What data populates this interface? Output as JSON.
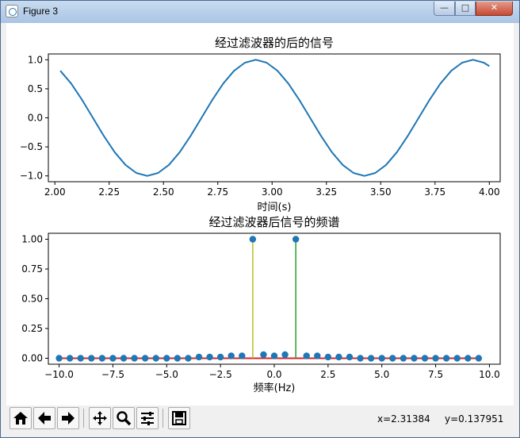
{
  "window": {
    "title": "Figure 3",
    "min_glyph": "—",
    "max_glyph": "□",
    "close_glyph": "✕"
  },
  "toolbar": {
    "buttons": [
      "home-icon",
      "back-arrow-icon",
      "forward-arrow-icon",
      "pan-icon",
      "zoom-icon",
      "subplots-config-icon",
      "save-icon"
    ],
    "x_readout": "x=2.31384",
    "y_readout": "y=0.137951"
  },
  "colors": {
    "line": "#1f77b4",
    "stem_neg": "#bcbd22",
    "stem_pos": "#2ca02c",
    "baseline": "#d62728",
    "marker": "#1f77b4"
  },
  "chart_data": [
    {
      "type": "line",
      "title": "经过滤波器的后的信号",
      "xlabel": "时间(s)",
      "ylabel": "",
      "xlim": [
        1.97,
        4.05
      ],
      "ylim": [
        -1.1,
        1.1
      ],
      "xticks": [
        2.0,
        2.25,
        2.5,
        2.75,
        3.0,
        3.25,
        3.5,
        3.75,
        4.0
      ],
      "xtick_labels": [
        "2.00",
        "2.25",
        "2.50",
        "2.75",
        "3.00",
        "3.25",
        "3.50",
        "3.75",
        "4.00"
      ],
      "yticks": [
        1.0,
        0.5,
        0.0,
        -0.5,
        -1.0
      ],
      "ytick_labels": [
        "1.0",
        "0.5",
        "0.0",
        "−0.5",
        "−1.0"
      ],
      "series": [
        {
          "x": [
            2.025,
            2.075,
            2.125,
            2.175,
            2.225,
            2.275,
            2.325,
            2.375,
            2.425,
            2.475,
            2.525,
            2.575,
            2.625,
            2.675,
            2.725,
            2.775,
            2.825,
            2.875,
            2.925,
            2.975,
            3.025,
            3.075,
            3.125,
            3.175,
            3.225,
            3.275,
            3.325,
            3.375,
            3.425,
            3.475,
            3.525,
            3.575,
            3.625,
            3.675,
            3.725,
            3.775,
            3.825,
            3.875,
            3.925,
            3.975,
            4.0
          ],
          "y": [
            0.81,
            0.59,
            0.31,
            0.0,
            -0.31,
            -0.59,
            -0.81,
            -0.95,
            -1.0,
            -0.95,
            -0.81,
            -0.59,
            -0.31,
            0.0,
            0.31,
            0.59,
            0.81,
            0.95,
            1.0,
            0.95,
            0.81,
            0.59,
            0.31,
            0.0,
            -0.31,
            -0.59,
            -0.81,
            -0.95,
            -1.0,
            -0.95,
            -0.81,
            -0.59,
            -0.31,
            0.0,
            0.31,
            0.59,
            0.81,
            0.95,
            1.0,
            0.95,
            0.89
          ]
        }
      ],
      "grid": false
    },
    {
      "type": "stem",
      "title": "经过滤波器后信号的频谱",
      "xlabel": "频率(Hz)",
      "ylabel": "",
      "xlim": [
        -10.5,
        10.5
      ],
      "ylim": [
        -0.05,
        1.05
      ],
      "xticks": [
        -10.0,
        -7.5,
        -5.0,
        -2.5,
        0.0,
        2.5,
        5.0,
        7.5,
        10.0
      ],
      "xtick_labels": [
        "−10.0",
        "−7.5",
        "−5.0",
        "−2.5",
        "0.0",
        "2.5",
        "5.0",
        "7.5",
        "10.0"
      ],
      "yticks": [
        1.0,
        0.75,
        0.5,
        0.25,
        0.0
      ],
      "ytick_labels": [
        "1.00",
        "0.75",
        "0.50",
        "0.25",
        "0.00"
      ],
      "x": [
        -10.0,
        -9.5,
        -9.0,
        -8.5,
        -8.0,
        -7.5,
        -7.0,
        -6.5,
        -6.0,
        -5.5,
        -5.0,
        -4.5,
        -4.0,
        -3.5,
        -3.0,
        -2.5,
        -2.0,
        -1.5,
        -1.0,
        -0.5,
        0.0,
        0.5,
        1.0,
        1.5,
        2.0,
        2.5,
        3.0,
        3.5,
        4.0,
        4.5,
        5.0,
        5.5,
        6.0,
        6.5,
        7.0,
        7.5,
        8.0,
        8.5,
        9.0,
        9.5
      ],
      "y": [
        0.0,
        0.0,
        0.0,
        0.0,
        0.0,
        0.0,
        0.0,
        0.0,
        0.0,
        0.0,
        0.0,
        0.0,
        0.0,
        0.01,
        0.01,
        0.01,
        0.02,
        0.02,
        1.0,
        0.03,
        0.02,
        0.03,
        1.0,
        0.02,
        0.02,
        0.01,
        0.01,
        0.01,
        0.0,
        0.0,
        0.0,
        0.0,
        0.0,
        0.0,
        0.0,
        0.0,
        0.0,
        0.0,
        0.0,
        0.0
      ],
      "grid": false
    }
  ]
}
